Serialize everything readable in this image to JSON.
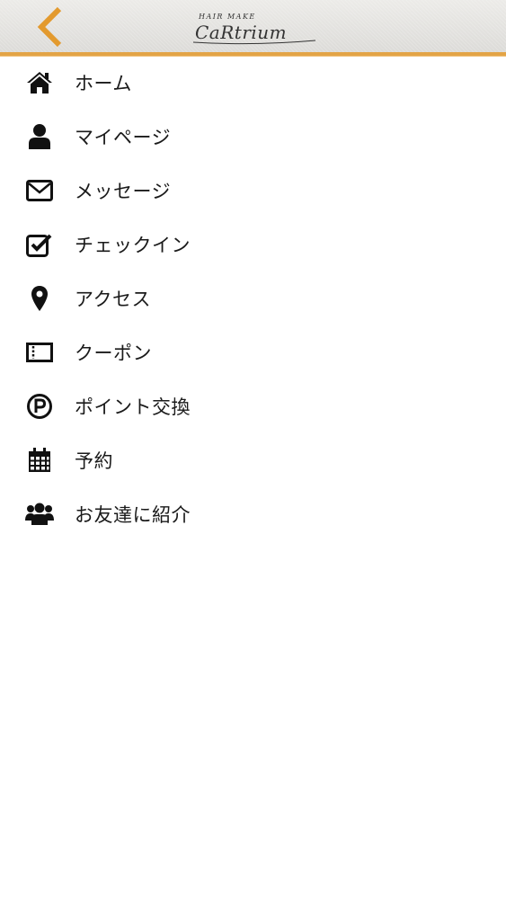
{
  "header": {
    "logo_top_text": "HAIR MAKE",
    "logo_main_text": "CaRtrium",
    "accent_color": "#e39a2e",
    "back_icon": "chevron-left-icon"
  },
  "menu": {
    "items": [
      {
        "label": "ホーム",
        "icon": "home-icon"
      },
      {
        "label": "マイページ",
        "icon": "user-icon"
      },
      {
        "label": "メッセージ",
        "icon": "envelope-icon"
      },
      {
        "label": "チェックイン",
        "icon": "checkbox-icon"
      },
      {
        "label": "アクセス",
        "icon": "map-pin-icon"
      },
      {
        "label": "クーポン",
        "icon": "ticket-icon"
      },
      {
        "label": "ポイント交換",
        "icon": "point-icon"
      },
      {
        "label": "予約",
        "icon": "calendar-icon"
      },
      {
        "label": "お友達に紹介",
        "icon": "users-icon"
      }
    ]
  }
}
